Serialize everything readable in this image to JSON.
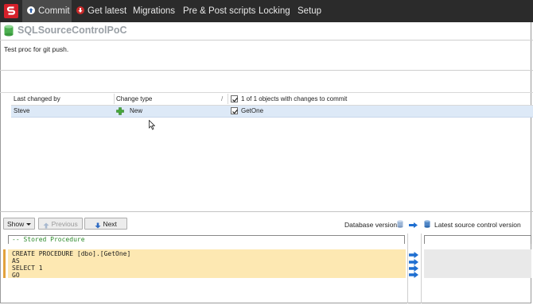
{
  "nav": {
    "tabs": [
      {
        "label": "Commit",
        "icon": "commit-up-arrow-icon",
        "active": true
      },
      {
        "label": "Get latest",
        "icon": "get-latest-down-arrow-icon",
        "active": false
      },
      {
        "label": "Migrations",
        "active": false
      },
      {
        "label": "Pre & Post scripts",
        "active": false
      },
      {
        "label": "Locking",
        "active": false
      },
      {
        "label": "Setup",
        "active": false
      }
    ]
  },
  "header": {
    "database_name": "SQLSourceControlPoC"
  },
  "commit": {
    "message": "Test proc for git push."
  },
  "grid": {
    "columns": [
      "Last changed by",
      "Change type",
      "/",
      "1 of 1 objects with changes to commit"
    ],
    "rows": [
      {
        "last_changed_by": "Steve",
        "change_type": "New",
        "object": "GetOne",
        "checked": true
      }
    ],
    "header_checked": true
  },
  "diff_toolbar": {
    "show_label": "Show",
    "previous_label": "Previous",
    "next_label": "Next",
    "database_version_label": "Database version",
    "source_control_label": "Latest source control version"
  },
  "code": {
    "lines": [
      "-- Stored Procedure",
      "",
      "CREATE PROCEDURE [dbo].[GetOne]",
      "AS",
      "SELECT 1",
      "GO"
    ]
  },
  "colors": {
    "topbar": "#2b2b2b",
    "logo": "#d5202a",
    "selected_row": "#dde9f7",
    "diff_highlight": "#fde8b2",
    "arrow_blue": "#1f6fd1",
    "comment_green": "#2e8b2e"
  }
}
